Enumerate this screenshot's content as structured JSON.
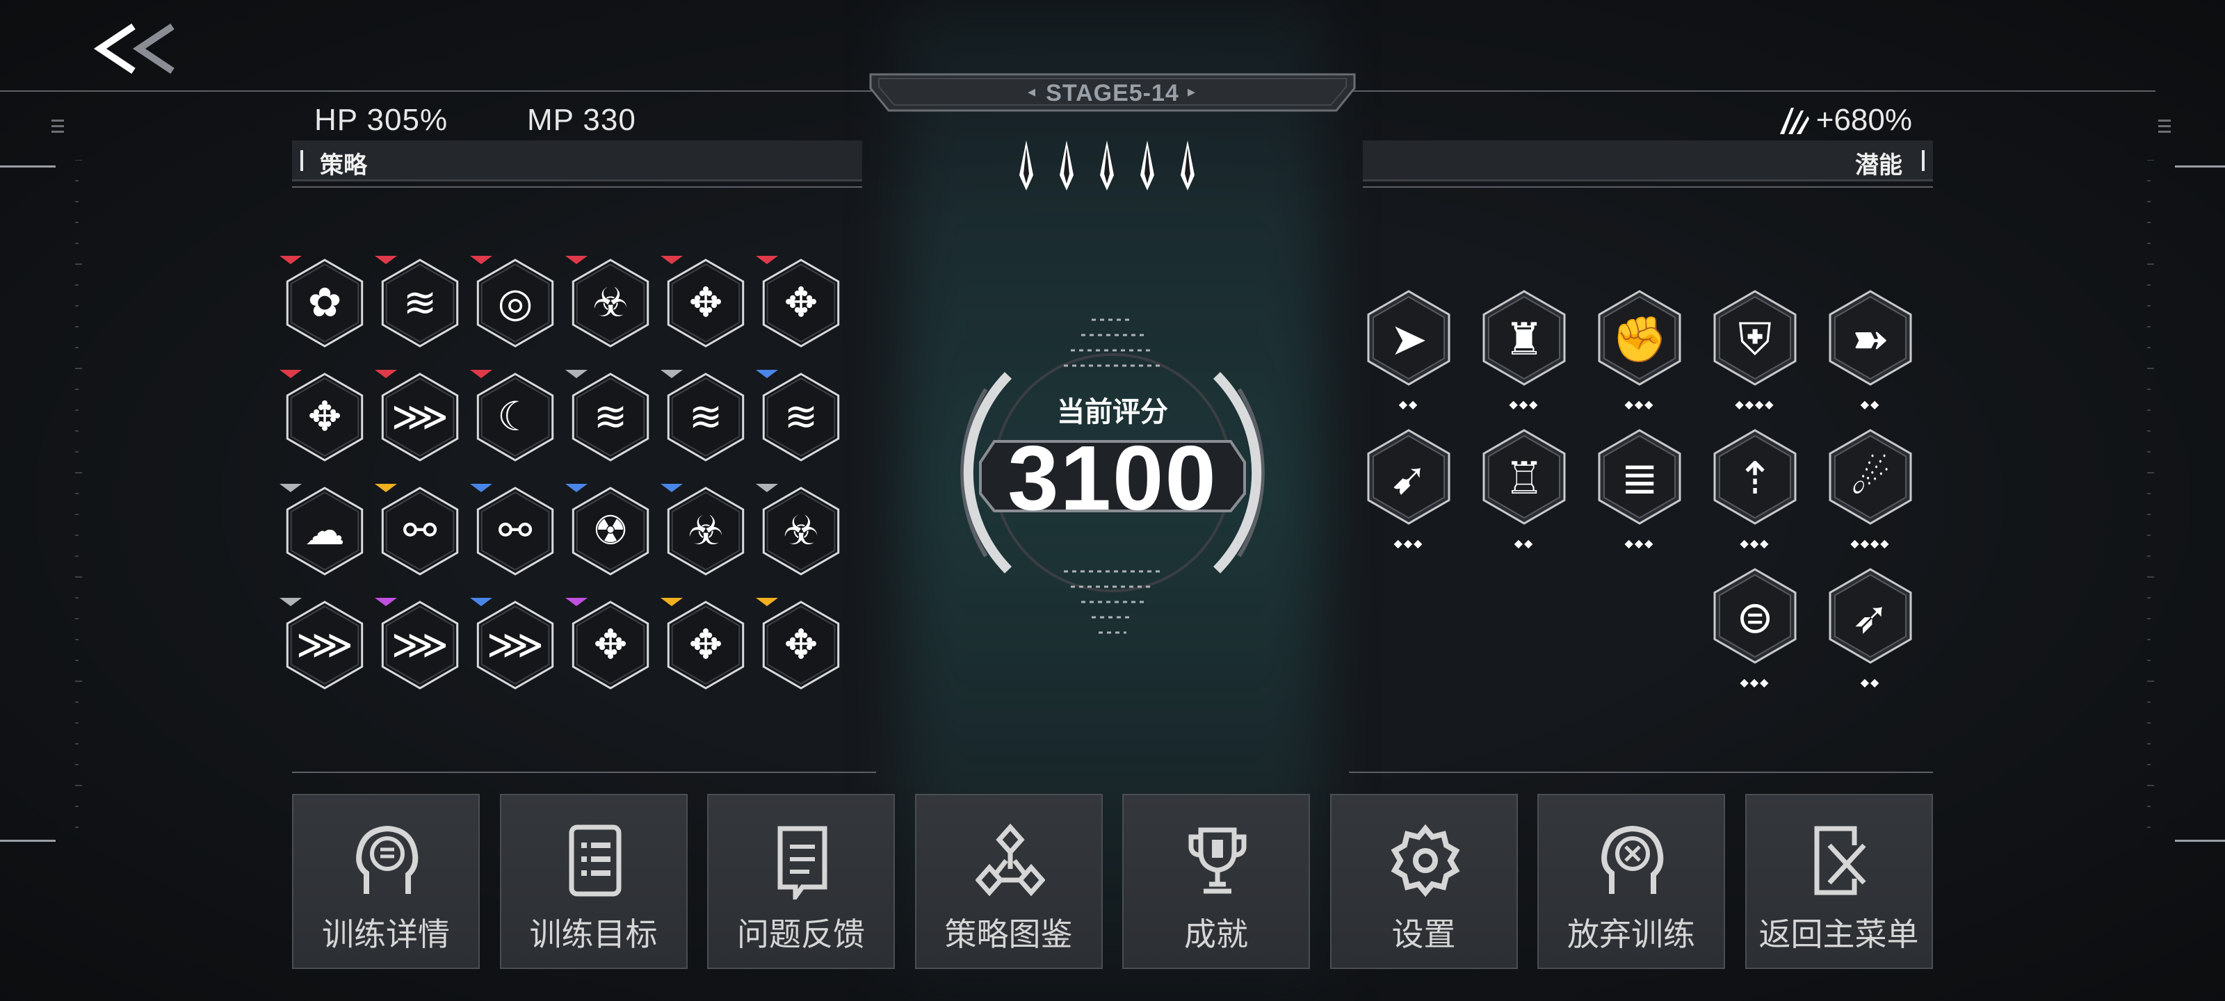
{
  "header": {
    "back_icon": "double-chevron-left-icon",
    "stage_label": "STAGE5-14",
    "hp_text": "HP 305%",
    "mp_text": "MP 330",
    "potential_bonus": "+680%",
    "potential_bonus_icon": "claw-slash-icon"
  },
  "strategy": {
    "title": "策略",
    "skills": [
      {
        "icon": "flower-burst-icon",
        "rarity": "red"
      },
      {
        "icon": "wind-diamonds-icon",
        "rarity": "red"
      },
      {
        "icon": "target-biohazard-icon",
        "rarity": "red"
      },
      {
        "icon": "biohazard-icon",
        "rarity": "red"
      },
      {
        "icon": "crosshair-wind-icon",
        "rarity": "red"
      },
      {
        "icon": "crosshair-icon",
        "rarity": "red"
      },
      {
        "icon": "crosshair-spark-icon",
        "rarity": "red"
      },
      {
        "icon": "claw-burst-icon",
        "rarity": "red"
      },
      {
        "icon": "crescent-slash-icon",
        "rarity": "red"
      },
      {
        "icon": "wind-diamonds-icon",
        "rarity": "gray"
      },
      {
        "icon": "wind-diamonds-plus-icon",
        "rarity": "gray"
      },
      {
        "icon": "wind-diamonds-plus-icon",
        "rarity": "blue"
      },
      {
        "icon": "storm-cloud-icon",
        "rarity": "gray"
      },
      {
        "icon": "node-link-plus-icon",
        "rarity": "yellow"
      },
      {
        "icon": "node-link-icon",
        "rarity": "blue"
      },
      {
        "icon": "radiation-icon",
        "rarity": "blue"
      },
      {
        "icon": "biohazard-icon",
        "rarity": "blue"
      },
      {
        "icon": "biohazard-forward-icon",
        "rarity": "gray"
      },
      {
        "icon": "claw-slash-icon",
        "rarity": "gray"
      },
      {
        "icon": "claw-slash-forward-icon",
        "rarity": "purple"
      },
      {
        "icon": "claw-slash-timer-icon",
        "rarity": "blue"
      },
      {
        "icon": "crosshair-icon",
        "rarity": "purple"
      },
      {
        "icon": "crosshair-star-icon",
        "rarity": "yellow"
      },
      {
        "icon": "crosshair-bars-icon",
        "rarity": "yellow"
      }
    ]
  },
  "potential": {
    "title": "潜能",
    "items": [
      {
        "icon": "dash-runner-icon",
        "level": 2
      },
      {
        "icon": "spike-wall-icon",
        "level": 3
      },
      {
        "icon": "fist-impact-icon",
        "level": 3
      },
      {
        "icon": "shield-blade-icon",
        "level": 4
      },
      {
        "icon": "bullet-icon",
        "level": 2
      },
      {
        "icon": "sprint-runner-icon",
        "level": 3
      },
      {
        "icon": "crystal-tower-icon",
        "level": 2
      },
      {
        "icon": "blade-stack-icon",
        "level": 3
      },
      {
        "icon": "rising-foot-icon",
        "level": 3
      },
      {
        "icon": "meteor-icon",
        "level": 4
      },
      {
        "icon": "orbit-slash-icon",
        "level": 3
      },
      {
        "icon": "spear-burst-icon",
        "level": 2
      }
    ]
  },
  "score": {
    "title": "当前评分",
    "value": "3100"
  },
  "kunai_count": 5,
  "menu": [
    {
      "label": "训练详情",
      "icon": "head-profile-list-icon"
    },
    {
      "label": "训练目标",
      "icon": "document-list-icon"
    },
    {
      "label": "问题反馈",
      "icon": "feedback-doc-icon"
    },
    {
      "label": "策略图鉴",
      "icon": "codex-tri-icon"
    },
    {
      "label": "成就",
      "icon": "trophy-icon"
    },
    {
      "label": "设置",
      "icon": "gear-icon"
    },
    {
      "label": "放弃训练",
      "icon": "head-profile-x-icon"
    },
    {
      "label": "返回主菜单",
      "icon": "exit-door-icon"
    }
  ],
  "colors": {
    "red": "#e03a4a",
    "gray": "#b0b4b8",
    "blue": "#4a86e8",
    "yellow": "#f0b020",
    "purple": "#c050e0"
  }
}
